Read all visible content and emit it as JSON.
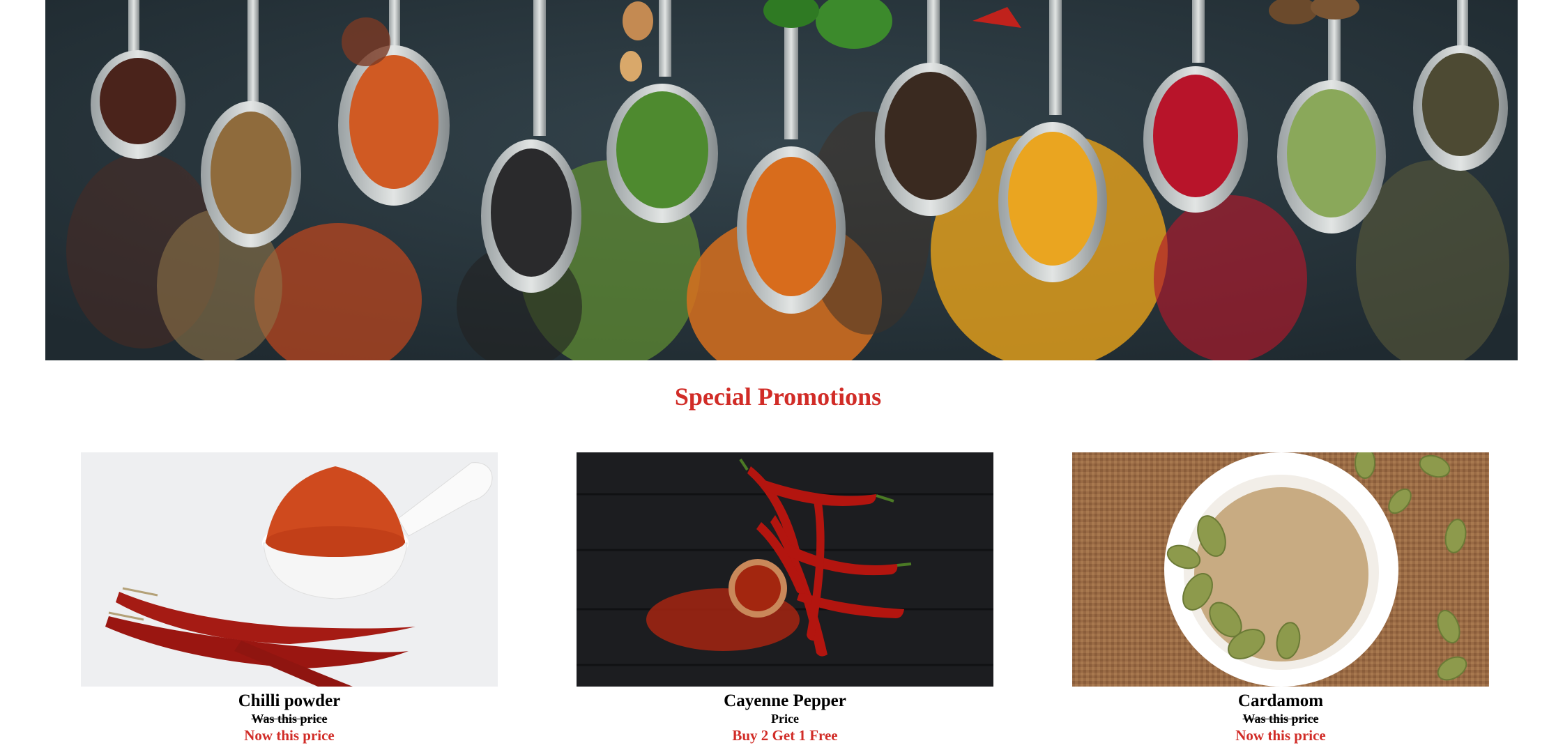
{
  "hero": {
    "image": "spices-on-spoons-banner"
  },
  "section": {
    "title": "Special Promotions"
  },
  "products": [
    {
      "name": "Chilli powder",
      "old_price": "Was this price",
      "new_price": "Now this price",
      "image": "chilli-powder-photo"
    },
    {
      "name": "Cayenne Pepper",
      "old_price": "Price",
      "new_price": "Buy 2 Get 1 Free",
      "image": "cayenne-pepper-photo"
    },
    {
      "name": "Cardamom",
      "old_price": "Was this price",
      "new_price": "Now this price",
      "image": "cardamom-photo"
    }
  ],
  "colors": {
    "accent": "#d12c27",
    "hero_bg": "#27343b"
  }
}
